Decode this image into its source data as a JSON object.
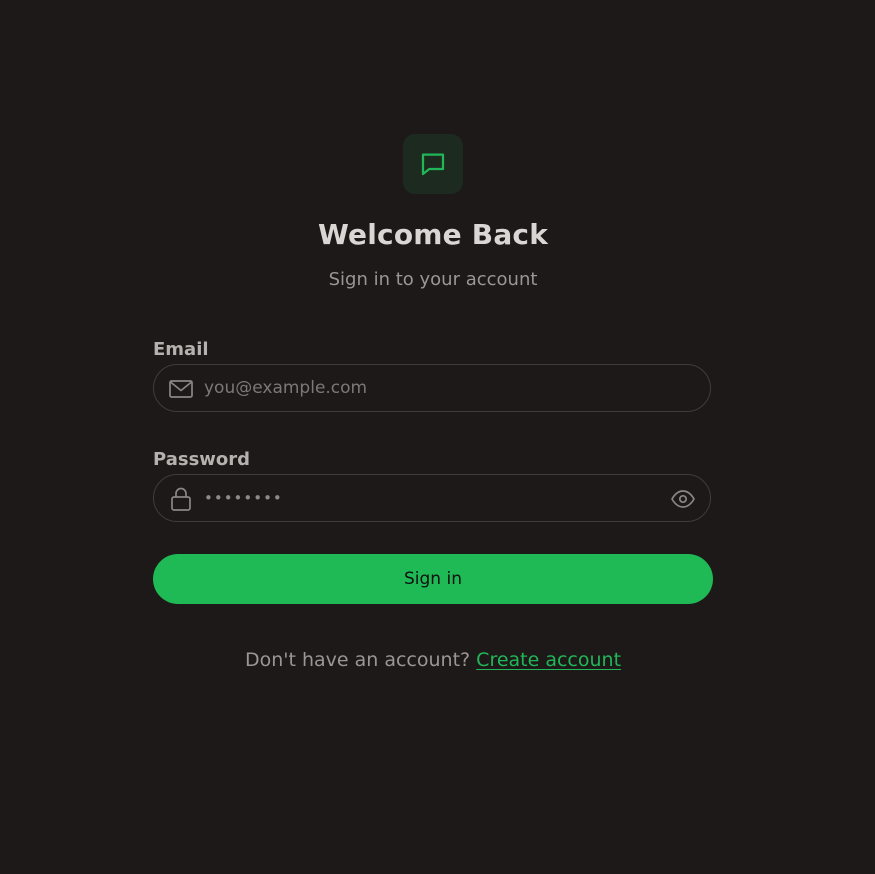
{
  "header": {
    "title": "Welcome Back",
    "subtitle": "Sign in to your account",
    "logo_icon": "chat-bubble-icon"
  },
  "form": {
    "email": {
      "label": "Email",
      "placeholder": "you@example.com",
      "value": "",
      "icon": "mail-icon"
    },
    "password": {
      "label": "Password",
      "value": "••••••••",
      "icon": "lock-icon",
      "toggle_icon": "eye-icon"
    },
    "submit_label": "Sign in"
  },
  "footer": {
    "prompt": "Don't have an account?",
    "link_label": "Create account"
  },
  "colors": {
    "background": "#1c1918",
    "accent": "#1fb955",
    "logo_tile": "#1c2a1f"
  }
}
